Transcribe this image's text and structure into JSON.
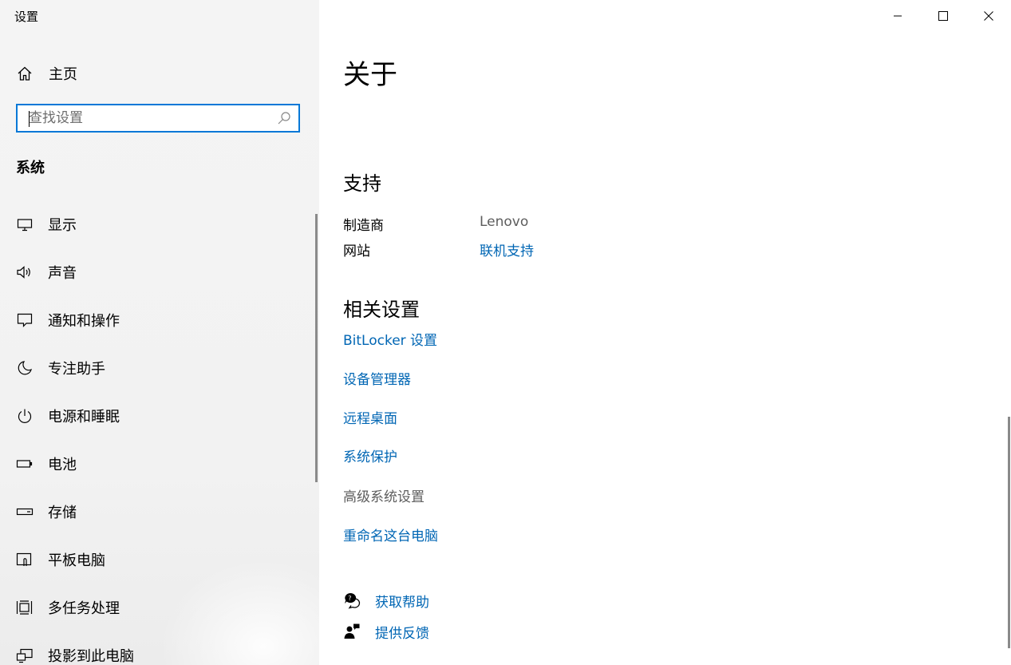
{
  "window": {
    "title": "设置"
  },
  "sidebar": {
    "home_label": "主页",
    "search_placeholder": "查找设置",
    "section_title": "系统",
    "items": [
      {
        "label": "显示",
        "icon": "monitor-icon"
      },
      {
        "label": "声音",
        "icon": "speaker-icon"
      },
      {
        "label": "通知和操作",
        "icon": "notification-icon"
      },
      {
        "label": "专注助手",
        "icon": "moon-icon"
      },
      {
        "label": "电源和睡眠",
        "icon": "power-icon"
      },
      {
        "label": "电池",
        "icon": "battery-icon"
      },
      {
        "label": "存储",
        "icon": "storage-icon"
      },
      {
        "label": "平板电脑",
        "icon": "tablet-icon"
      },
      {
        "label": "多任务处理",
        "icon": "multitask-icon"
      },
      {
        "label": "投影到此电脑",
        "icon": "project-icon"
      }
    ]
  },
  "main": {
    "page_title": "关于",
    "support": {
      "title": "支持",
      "manufacturer_key": "制造商",
      "manufacturer_value": "Lenovo",
      "website_key": "网站",
      "website_value": "联机支持"
    },
    "related": {
      "title": "相关设置",
      "links": [
        {
          "label": "BitLocker 设置",
          "enabled": true
        },
        {
          "label": "设备管理器",
          "enabled": true
        },
        {
          "label": "远程桌面",
          "enabled": true
        },
        {
          "label": "系统保护",
          "enabled": true
        },
        {
          "label": "高级系统设置",
          "enabled": false
        },
        {
          "label": "重命名这台电脑",
          "enabled": true
        }
      ]
    },
    "help": {
      "get_help": "获取帮助",
      "feedback": "提供反馈"
    }
  },
  "colors": {
    "accent": "#0078d7",
    "link": "#0066b4",
    "sidebar_bg": "#f2f2f2",
    "muted_text": "#5d5d5d"
  }
}
